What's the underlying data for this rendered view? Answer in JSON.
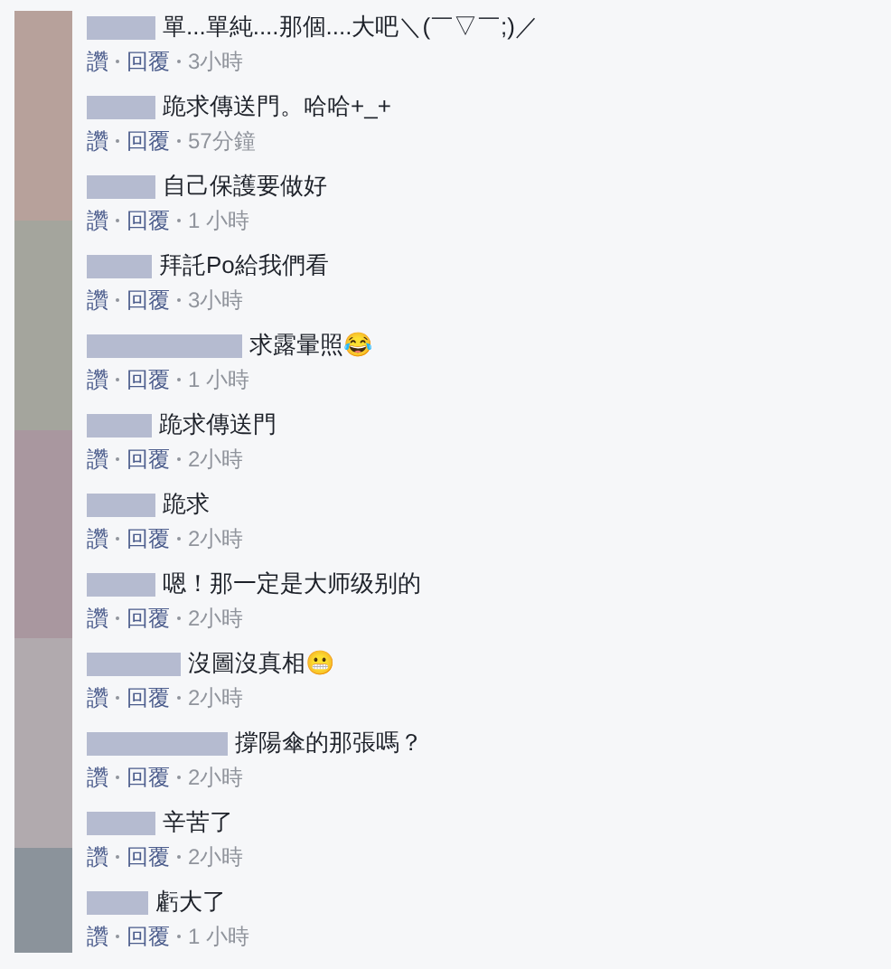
{
  "comments": [
    {
      "text": "單...單純....那個....大吧＼(￣▽￣;)／",
      "like": "讚",
      "reply": "回覆",
      "time": "3小時"
    },
    {
      "text": "跪求傳送門。哈哈+_+",
      "like": "讚",
      "reply": "回覆",
      "time": "57分鐘"
    },
    {
      "text": "自己保護要做好",
      "like": "讚",
      "reply": "回覆",
      "time": "1 小時"
    },
    {
      "text": "拜託Po給我們看",
      "like": "讚",
      "reply": "回覆",
      "time": "3小時"
    },
    {
      "text": "求露暈照😂",
      "like": "讚",
      "reply": "回覆",
      "time": "1 小時"
    },
    {
      "text": "跪求傳送門",
      "like": "讚",
      "reply": "回覆",
      "time": "2小時"
    },
    {
      "text": "跪求",
      "like": "讚",
      "reply": "回覆",
      "time": "2小時"
    },
    {
      "text": "嗯！那一定是大师级别的",
      "like": "讚",
      "reply": "回覆",
      "time": "2小時"
    },
    {
      "text": "沒圖沒真相😬",
      "like": "讚",
      "reply": "回覆",
      "time": "2小時"
    },
    {
      "text": "撐陽傘的那張嗎？",
      "like": "讚",
      "reply": "回覆",
      "time": "2小時"
    },
    {
      "text": "辛苦了",
      "like": "讚",
      "reply": "回覆",
      "time": "2小時"
    },
    {
      "text": "虧大了",
      "like": "讚",
      "reply": "回覆",
      "time": "1 小時"
    }
  ]
}
